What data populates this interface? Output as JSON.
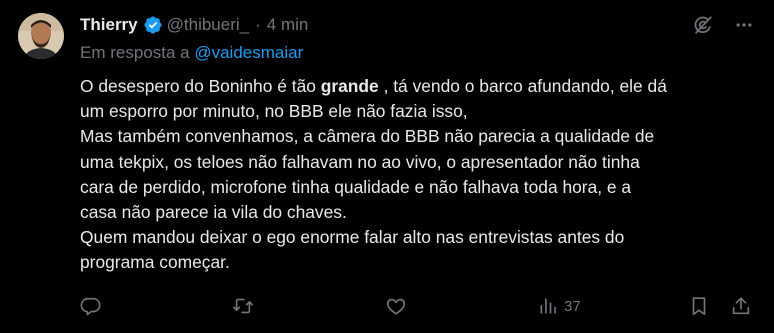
{
  "author": {
    "display_name": "Thierry",
    "handle": "@thibueri_",
    "separator": "·",
    "time": "4 min"
  },
  "reply": {
    "prefix": "Em resposta a ",
    "mention": "@vaidesmaiar"
  },
  "body": {
    "l1_before": "O desespero do Boninho é tão ",
    "l1_bold": "grande",
    "l1_after": " , tá vendo o barco afundando, ele dá",
    "l2": "um esporro por minuto, no BBB ele não fazia isso,",
    "l3": "Mas também convenhamos, a câmera do BBB não parecia a qualidade de",
    "l4": "uma tekpix, os teloes não falhavam no ao vivo, o apresentador não tinha",
    "l5": "cara de perdido, microfone tinha qualidade e não falhava toda hora, e a",
    "l6": "casa não parece ia vila do chaves.",
    "l7": "Quem mandou deixar o ego enorme falar alto nas entrevistas antes do",
    "l8": "programa começar."
  },
  "actions": {
    "views_count": "37"
  },
  "icons": {
    "verified": "verified-badge-icon",
    "grok": "grok-icon",
    "more": "more-icon",
    "reply": "reply-icon",
    "repost": "repost-icon",
    "like": "like-icon",
    "views": "views-icon",
    "bookmark": "bookmark-icon",
    "share": "share-icon"
  },
  "colors": {
    "background": "#000000",
    "text": "#e7e9ea",
    "muted": "#71767b",
    "accent": "#1d9bf0"
  }
}
